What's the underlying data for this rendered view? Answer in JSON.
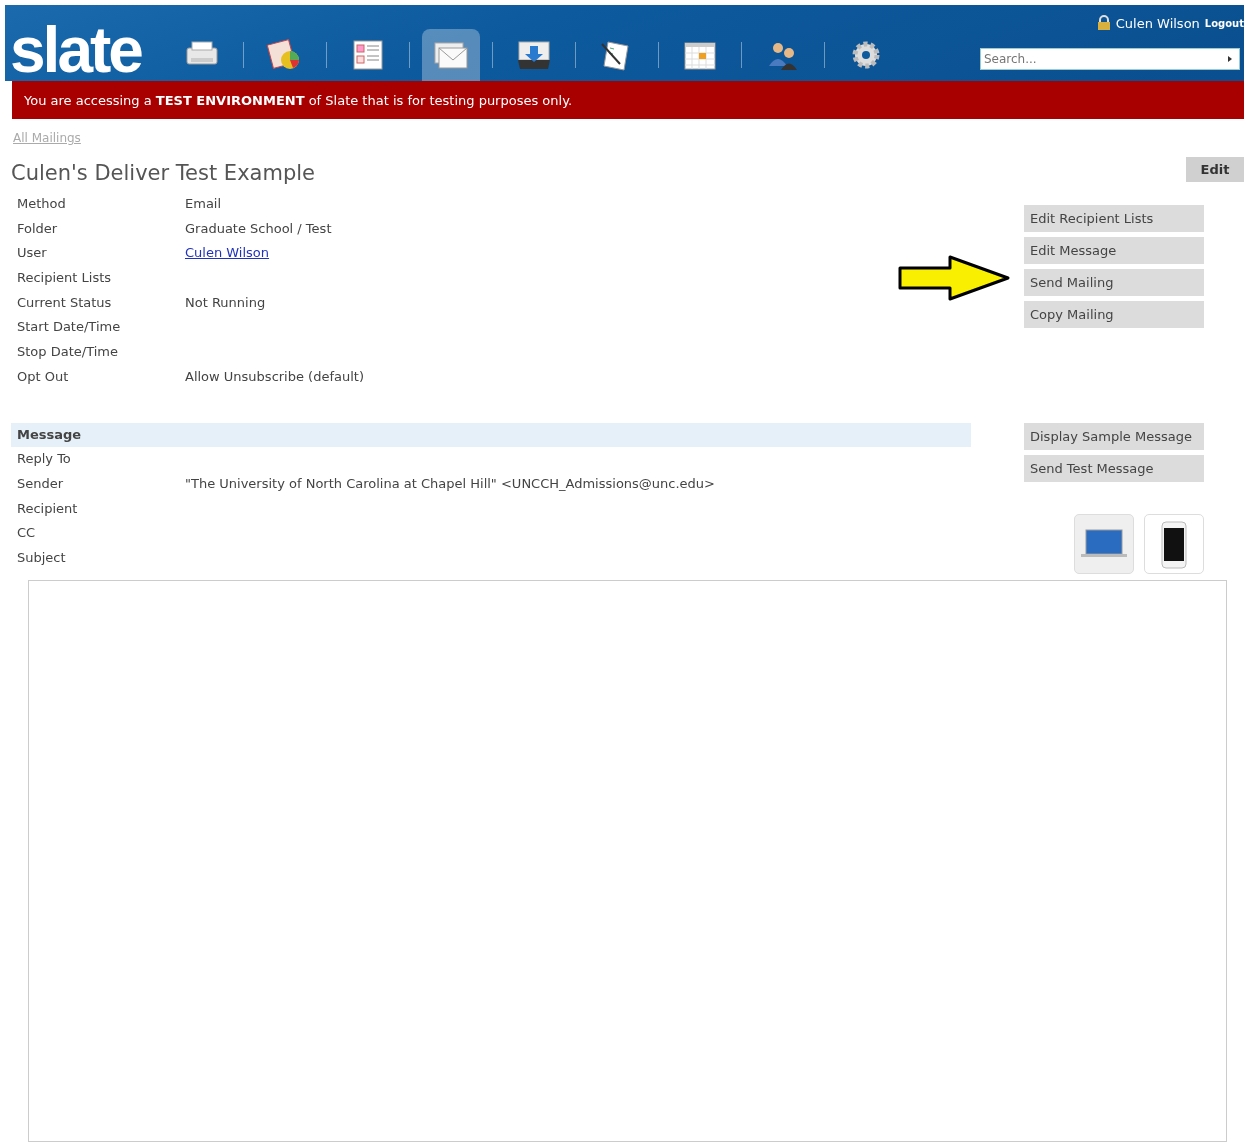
{
  "header": {
    "logo": "slate",
    "nav": [
      {
        "kind": "printer",
        "selected": false
      },
      {
        "kind": "chart",
        "selected": false
      },
      {
        "kind": "form",
        "selected": false
      },
      {
        "kind": "mail",
        "selected": true
      },
      {
        "kind": "inbox",
        "selected": false
      },
      {
        "kind": "document",
        "selected": false
      },
      {
        "kind": "calendar",
        "selected": false
      },
      {
        "kind": "people",
        "selected": false
      },
      {
        "kind": "gear",
        "selected": false
      }
    ],
    "user": "Culen Wilson",
    "logout": "Logout",
    "search": {
      "placeholder": "Search..."
    }
  },
  "banner": "You are accessing a **TEST ENVIRONMENT** of Slate that is for testing purposes only.",
  "breadcrumb": "All Mailings",
  "title": "Culen's Deliver Test Example",
  "edit_button": "Edit",
  "details": [
    {
      "label": "Method",
      "value": "Email",
      "kind": "text"
    },
    {
      "label": "Folder",
      "value": "Graduate School / Test",
      "kind": "text"
    },
    {
      "label": "User",
      "value": "Culen Wilson",
      "kind": "link"
    },
    {
      "label": "Recipient Lists"
    },
    {
      "label": "Current Status",
      "value": "Not Running",
      "kind": "text"
    },
    {
      "label": "Start Date/Time"
    },
    {
      "label": "Stop Date/Time"
    },
    {
      "label": "Opt Out",
      "value": "Allow Unsubscribe (default)",
      "kind": "text"
    }
  ],
  "actions": [
    "Edit Recipient Lists",
    "Edit Message",
    "Send Mailing",
    "Copy Mailing"
  ],
  "message": {
    "heading": "Message",
    "fields": [
      {
        "label": "Reply To"
      },
      {
        "label": "Sender",
        "value": "\"The University of North Carolina at Chapel Hill\" <UNCCH_Admissions@unc.edu>"
      },
      {
        "label": "Recipient"
      },
      {
        "label": "CC"
      },
      {
        "label": "Subject"
      }
    ],
    "actions": [
      "Display Sample Message",
      "Send Test Message"
    ],
    "devices": [
      {
        "kind": "laptop",
        "selected": true
      },
      {
        "kind": "phone",
        "selected": false
      }
    ]
  }
}
